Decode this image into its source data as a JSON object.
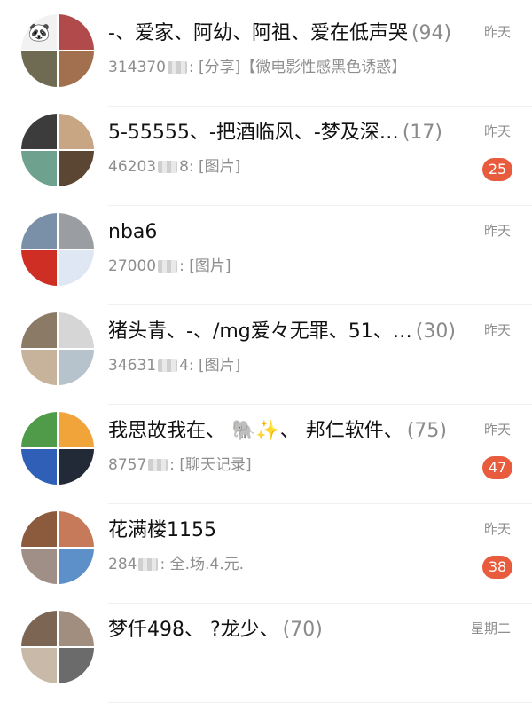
{
  "chats": [
    {
      "title": "-、爱家、阿幼、阿祖、爱在低声哭",
      "count": "(94)",
      "preview_prefix": "314370",
      "preview_suffix": ": [分享]【微电影性感黑色诱惑】",
      "time": "昨天",
      "badge": "",
      "avatar_tiles": [
        {
          "icon": "panda-icon",
          "glyph": "🐼",
          "color": "#f2f2f2"
        },
        {
          "icon": "",
          "glyph": "",
          "color": "#b14a4a"
        },
        {
          "icon": "",
          "glyph": "",
          "color": "#6f6a52"
        },
        {
          "icon": "",
          "glyph": "",
          "color": "#a2704e"
        }
      ]
    },
    {
      "title": "5-55555、-把酒临风、-梦及深…",
      "count": "(17)",
      "preview_prefix": "46203",
      "preview_suffix": "8: [图片]",
      "time": "昨天",
      "badge": "25",
      "avatar_tiles": [
        {
          "icon": "",
          "glyph": "",
          "color": "#3c3c3c"
        },
        {
          "icon": "",
          "glyph": "",
          "color": "#c8a684"
        },
        {
          "icon": "",
          "glyph": "",
          "color": "#6fa18f"
        },
        {
          "icon": "",
          "glyph": "",
          "color": "#5b4634"
        }
      ]
    },
    {
      "title": "nba6",
      "count": "",
      "preview_prefix": "27000",
      "preview_suffix": ": [图片]",
      "time": "昨天",
      "badge": "",
      "avatar_tiles": [
        {
          "icon": "",
          "glyph": "",
          "color": "#7a8fa8"
        },
        {
          "icon": "",
          "glyph": "",
          "color": "#9a9ea3"
        },
        {
          "icon": "",
          "glyph": "",
          "color": "#cf2e24"
        },
        {
          "icon": "",
          "glyph": "",
          "color": "#dfe6f4"
        }
      ]
    },
    {
      "title": "猪头青、-、/mg爱々无罪、51、…",
      "count": "(30)",
      "preview_prefix": "34631",
      "preview_suffix": "4: [图片]",
      "time": "昨天",
      "badge": "",
      "avatar_tiles": [
        {
          "icon": "",
          "glyph": "",
          "color": "#8a7a66"
        },
        {
          "icon": "",
          "glyph": "",
          "color": "#d6d6d6"
        },
        {
          "icon": "",
          "glyph": "",
          "color": "#c7b39b"
        },
        {
          "icon": "",
          "glyph": "",
          "color": "#b6c2cc"
        }
      ]
    },
    {
      "title": "我思故我在、 🐘✨、 邦仁软件、",
      "count": "(75)",
      "preview_prefix": "8757",
      "preview_suffix": ": [聊天记录]",
      "time": "昨天",
      "badge": "47",
      "avatar_tiles": [
        {
          "icon": "",
          "glyph": "",
          "color": "#4f9b4a"
        },
        {
          "icon": "",
          "glyph": "",
          "color": "#f0a43a"
        },
        {
          "icon": "",
          "glyph": "",
          "color": "#2f5fb6"
        },
        {
          "icon": "",
          "glyph": "",
          "color": "#222a38"
        }
      ]
    },
    {
      "title": "花满楼1155",
      "count": "",
      "preview_prefix": "284",
      "preview_suffix": ": 全.场.4.元.",
      "time": "昨天",
      "badge": "38",
      "avatar_tiles": [
        {
          "icon": "",
          "glyph": "",
          "color": "#8c5a3c"
        },
        {
          "icon": "",
          "glyph": "",
          "color": "#c77a5a"
        },
        {
          "icon": "",
          "glyph": "",
          "color": "#9f8f86"
        },
        {
          "icon": "",
          "glyph": "",
          "color": "#5d8fc9"
        }
      ]
    },
    {
      "title": "梦仟498、 ?龙少、",
      "count": "(70)",
      "preview_prefix": "",
      "preview_suffix": "",
      "time": "星期二",
      "badge": "",
      "avatar_tiles": [
        {
          "icon": "",
          "glyph": "",
          "color": "#7c6553"
        },
        {
          "icon": "",
          "glyph": "",
          "color": "#a18e7e"
        },
        {
          "icon": "",
          "glyph": "",
          "color": "#c9b9a8"
        },
        {
          "icon": "",
          "glyph": "",
          "color": "#6b6b6b"
        }
      ]
    }
  ]
}
